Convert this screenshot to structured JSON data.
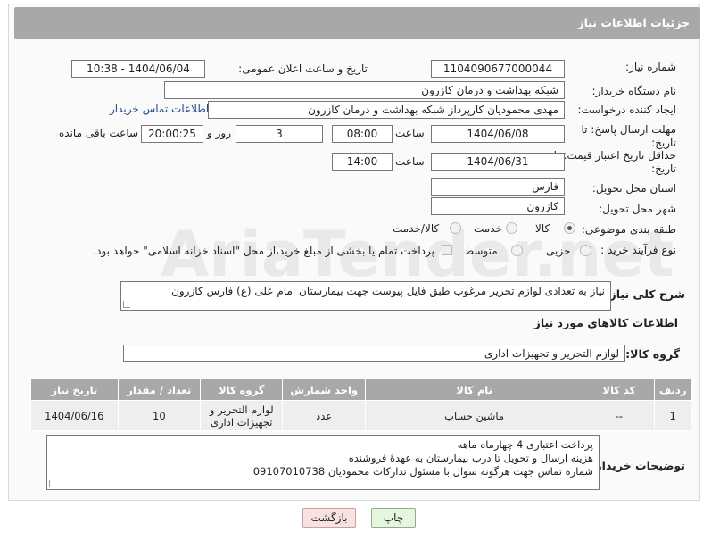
{
  "header": {
    "title": "جزئیات اطلاعات نیاز"
  },
  "form": {
    "need_number_label": "شماره نیاز:",
    "need_number": "1104090677000044",
    "announce_label": "تاریخ و ساعت اعلان عمومی:",
    "announce_value": "1404/06/04 - 10:38",
    "buyer_org_label": "نام دستگاه خریدار:",
    "buyer_org": "شبکه بهداشت و درمان کازرون",
    "creator_label": "ایجاد کننده درخواست:",
    "creator": "مهدی محمودیان کارپرداز شبکه بهداشت و درمان کازرون",
    "buyer_contact_link": "اطلاعات تماس خریدار",
    "deadline_label": "مهلت ارسال پاسخ: تا تاریخ:",
    "deadline_date": "1404/06/08",
    "time_label": "ساعت",
    "deadline_time": "08:00",
    "days_value": "3",
    "days_label": "روز و",
    "remaining_time": "20:00:25",
    "remaining_label": "ساعت باقی مانده",
    "price_validity_label": "حداقل تاریخ اعتبار قیمت: تا تاریخ:",
    "price_validity_date": "1404/06/31",
    "price_validity_time": "14:00",
    "province_label": "استان محل تحویل:",
    "province": "فارس",
    "city_label": "شهر محل تحویل:",
    "city": "کازرون",
    "category_label": "طبقه بندی موضوعی:",
    "category_options": [
      "کالا",
      "خدمت",
      "کالا/خدمت"
    ],
    "category_selected": "کالا",
    "process_label": "نوع فرآیند خرید :",
    "process_options": [
      "جزیی",
      "متوسط"
    ],
    "process_selected": "جزیی",
    "payment_note": "پرداخت تمام یا بخشی از مبلغ خرید،از محل \"اسناد خزانه اسلامی\" خواهد بود.",
    "description_label": "شرح کلی نیاز:",
    "description": "نیاز به تعدادی لوازم تحریر مرغوب طبق فایل  پیوست جهت بیمارستان امام علی (ع) فارس کازرون",
    "goods_info_title": "اطلاعات کالاهای مورد نیاز",
    "goods_group_label": "گروه کالا:",
    "goods_group": "لوازم التحریر و تجهیزات اداری"
  },
  "table": {
    "headers": [
      "ردیف",
      "کد کالا",
      "نام کالا",
      "واحد شمارش",
      "گروه کالا",
      "تعداد / مقدار",
      "تاریخ نیاز"
    ],
    "rows": [
      [
        "1",
        "--",
        "ماشین حساب",
        "عدد",
        "لوازم التحریر و تجهیزات اداری",
        "10",
        "1404/06/16"
      ]
    ]
  },
  "buyer_notes": {
    "label": "توضیحات خریدار:",
    "lines": [
      "پرداخت اعتباری 4 چهارماه ماهه",
      "هزینه ارسال و تحویل تا درب بیمارستان به عهدهٔ فروشنده",
      "شماره تماس جهت هرگونه سوال با مسئول تدارکات  محمودیان 09107010738"
    ]
  },
  "buttons": {
    "print": "چاپ",
    "back": "بازگشت"
  },
  "watermark": "AriaTender.net",
  "colors": {
    "header_bg": "#a8a8a8",
    "link": "#1a4e8a"
  }
}
